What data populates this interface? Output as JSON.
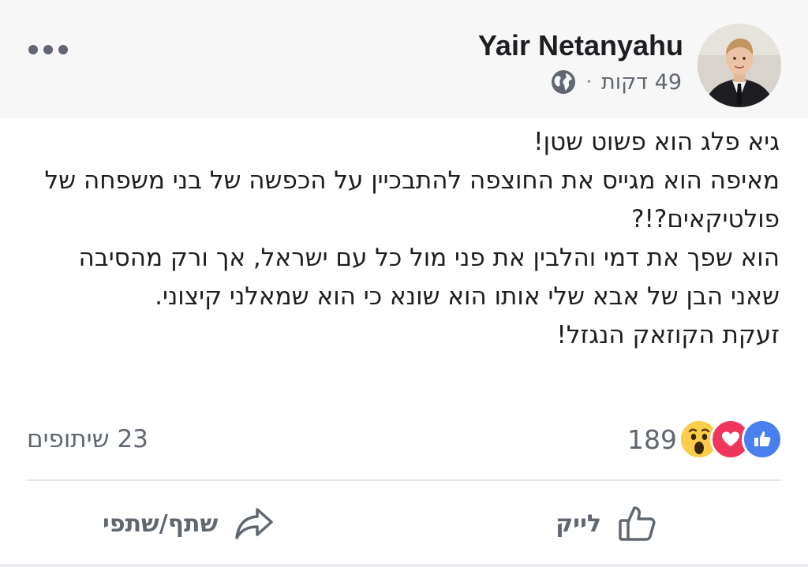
{
  "post": {
    "author": "Yair Netanyahu",
    "time": "49 דקות",
    "separator": "·",
    "privacy_icon": "globe-icon",
    "more_icon": "ellipsis-icon",
    "body_lines": [
      "גיא פלג הוא פשוט שטן!",
      "מאיפה הוא מגייס את החוצפה להתבכיין על הכפשה של בני משפחה של פולטיקאים?!?",
      "הוא שפך את דמי והלבין את פני מול כל עם ישראל, אך ורק מהסיבה שאני הבן של אבא שלי אותו הוא שונא כי הוא שמאלני קיצוני.",
      "זעקת הקוזאק הנגזל!"
    ]
  },
  "engagement": {
    "reaction_count": "189",
    "reactions": [
      "like-icon",
      "love-icon",
      "wow-icon"
    ],
    "shares": "23 שיתופים"
  },
  "actions": {
    "like_label": "לייק",
    "share_label": "שתף/שתפי"
  },
  "colors": {
    "like_blue": "#4a7ff0",
    "love_red": "#f0365a",
    "wow_yellow": "#fbcd4a",
    "meta_gray": "#606770",
    "header_bg": "#f7f7f7"
  }
}
